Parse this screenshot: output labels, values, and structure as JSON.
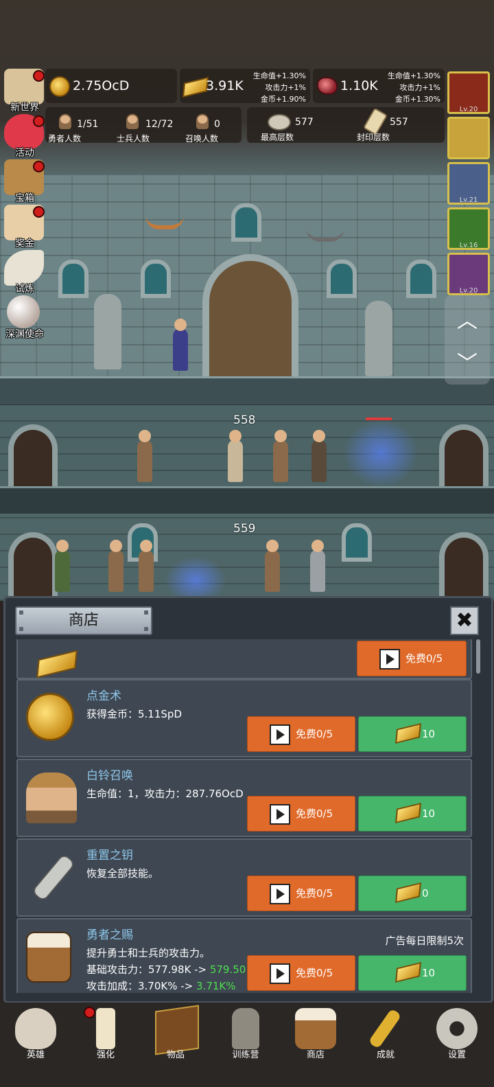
{
  "resources": {
    "gold": "2.75OcD",
    "gold_bar": "3.91K",
    "gem": "1.10K",
    "gold_bar_buffs": [
      "生命值+1.30%",
      "攻击力+1%",
      "金币+1.90%"
    ],
    "gem_buffs": [
      "生命值+1.30%",
      "攻击力+1%",
      "金币+1.30%"
    ]
  },
  "stats": {
    "hero_count": {
      "value": "1/51",
      "label": "勇者人数"
    },
    "soldier_count": {
      "value": "12/72",
      "label": "士兵人数"
    },
    "summon_count": {
      "value": "0",
      "label": "召唤人数"
    },
    "max_floor": {
      "value": "577",
      "label": "最高层数"
    },
    "sealed_floor": {
      "value": "557",
      "label": "封印层数"
    }
  },
  "side_menu": [
    {
      "label": "新世界",
      "icon": "map-icon",
      "badge": true
    },
    {
      "label": "活动",
      "icon": "heart-icon",
      "badge": true
    },
    {
      "label": "宝箱",
      "icon": "chest-icon",
      "badge": true
    },
    {
      "label": "奖金",
      "icon": "envelope-icon",
      "badge": true
    },
    {
      "label": "试炼",
      "icon": "feather-icon",
      "badge": false
    },
    {
      "label": "深渊使命",
      "icon": "pearl-icon",
      "badge": false
    }
  ],
  "pets": [
    {
      "level": "Lv.20",
      "color": "#8a2a1a"
    },
    {
      "level": "",
      "color": "#c8a23a"
    },
    {
      "level": "Lv.21",
      "color": "#4a5f8a"
    },
    {
      "level": "Lv.16",
      "color": "#3a7a2a"
    },
    {
      "level": "Lv.20",
      "color": "#6a3a7a"
    }
  ],
  "scene": {
    "floor_1": "558",
    "floor_2": "559"
  },
  "shop": {
    "title": "商店",
    "close": "✖",
    "ad_limit": "广告每日限制5次",
    "items": [
      {
        "title": "",
        "desc1": "",
        "ad_label": "免费0/5",
        "gold_label": ""
      },
      {
        "title": "点金术",
        "desc1": "获得金币：5.11SpD",
        "ad_label": "免费0/5",
        "gold_label": "10"
      },
      {
        "title": "白铃召唤",
        "desc1": "生命值：1，攻击力：287.76OcD",
        "ad_label": "免费0/5",
        "gold_label": "10"
      },
      {
        "title": "重置之钥",
        "desc1": "恢复全部技能。",
        "ad_label": "免费0/5",
        "gold_label": "0"
      },
      {
        "title": "勇者之赐",
        "desc1": "提升勇士和士兵的攻击力。",
        "desc2_prefix": "基础攻击力：577.98K -> ",
        "desc2_new": "579.50",
        "desc3_prefix": "攻击加成：3.70K% -> ",
        "desc3_new": "3.71K%",
        "ad_label": "免费0/5",
        "gold_label": "10"
      }
    ]
  },
  "bottom_nav": [
    {
      "label": "英雄",
      "icon": "skull-icon",
      "badge": false
    },
    {
      "label": "强化",
      "icon": "candle-icon",
      "badge": true
    },
    {
      "label": "物品",
      "icon": "book-icon",
      "badge": false
    },
    {
      "label": "训练营",
      "icon": "lantern-icon",
      "badge": false
    },
    {
      "label": "商店",
      "icon": "beer-mug-icon",
      "badge": false
    },
    {
      "label": "成就",
      "icon": "key-icon",
      "badge": false
    },
    {
      "label": "设置",
      "icon": "gear-icon",
      "badge": false
    }
  ],
  "colors": {
    "ad_button": "#e06a2a",
    "gold_button": "#45b66a",
    "item_title": "#8fc7ea",
    "upgrade_value": "#4fe04f",
    "badge": "#d21d1d"
  }
}
